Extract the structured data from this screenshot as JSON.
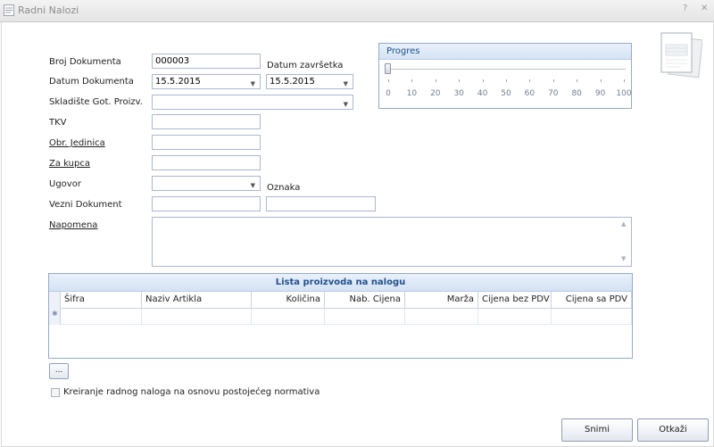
{
  "window": {
    "title": "Radni Nalozi",
    "help_glyph": "?",
    "close_glyph": "✕"
  },
  "form": {
    "broj_dokumenta": {
      "label": "Broj Dokumenta",
      "value": "000003"
    },
    "datum_zavrsetka": {
      "label": "Datum završetka",
      "value": "15.5.2015"
    },
    "datum_dokumenta": {
      "label": "Datum Dokumenta",
      "value": "15.5.2015"
    },
    "skladiste": {
      "label": "Skladište Got. Proizv.",
      "value": ""
    },
    "tkv": {
      "label": "TKV",
      "value": ""
    },
    "obr_jedinica": {
      "label": "Obr. Jedinica",
      "value": ""
    },
    "za_kupca": {
      "label": "Za kupca",
      "value": ""
    },
    "ugovor": {
      "label": "Ugovor",
      "value": ""
    },
    "oznaka": {
      "label": "Oznaka",
      "value": ""
    },
    "vezni_dokument": {
      "label": "Vezni Dokument",
      "value": ""
    },
    "napomena": {
      "label": "Napomena",
      "value": ""
    }
  },
  "progress": {
    "title": "Progres",
    "value": 0,
    "ticks": [
      "0",
      "10",
      "20",
      "30",
      "40",
      "50",
      "60",
      "70",
      "80",
      "90",
      "100"
    ]
  },
  "doc_icon": {
    "name": "purchase-order-icon",
    "text": "PURCHASE ORDER"
  },
  "grid": {
    "caption": "Lista proizvoda na nalogu",
    "columns": [
      "Šifra",
      "Naziv Artikla",
      "Količina",
      "Nab. Cijena",
      "Marža",
      "Cijena bez PDV",
      "Cijena sa PDV"
    ],
    "rows": []
  },
  "more_button": "...",
  "checkbox": {
    "label": "Kreiranje radnog naloga na osnovu postojećeg normativa",
    "checked": false
  },
  "buttons": {
    "save": "Snimi",
    "cancel": "Otkaži"
  }
}
